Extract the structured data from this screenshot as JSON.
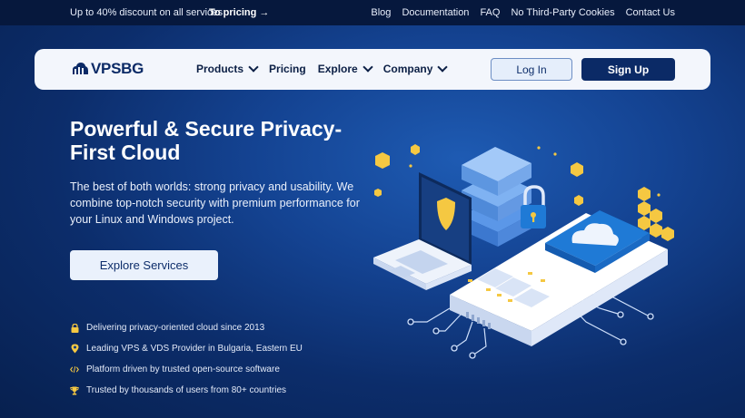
{
  "topbar": {
    "promo": "Up to 40% discount on all services",
    "promo_link": "To pricing →",
    "links": [
      "Blog",
      "Documentation",
      "FAQ",
      "No Third-Party Cookies",
      "Contact Us"
    ]
  },
  "navbar": {
    "logo_text": "VPSBG",
    "menu": [
      {
        "label": "Products",
        "dropdown": true
      },
      {
        "label": "Pricing",
        "dropdown": false
      },
      {
        "label": "Explore",
        "dropdown": true
      },
      {
        "label": "Company",
        "dropdown": true
      }
    ],
    "login_label": "Log In",
    "signup_label": "Sign Up"
  },
  "hero": {
    "title": "Powerful & Secure Privacy-First Cloud",
    "description": "The best of both worlds: strong privacy and usability. We combine top-notch security with premium performance for your Linux and Windows project.",
    "cta_label": "Explore Services"
  },
  "features": [
    {
      "icon": "lock-icon",
      "text": "Delivering privacy-oriented cloud since 2013"
    },
    {
      "icon": "map-pin-icon",
      "text": "Leading VPS & VDS Provider in Bulgaria, Eastern EU"
    },
    {
      "icon": "code-icon",
      "text": "Platform driven by trusted open-source software"
    },
    {
      "icon": "trophy-icon",
      "text": "Trusted by thousands of users from 80+ countries"
    }
  ],
  "colors": {
    "accent_gold": "#f5c842",
    "brand_navy": "#0b2a66",
    "topbar_bg": "#06183d"
  }
}
